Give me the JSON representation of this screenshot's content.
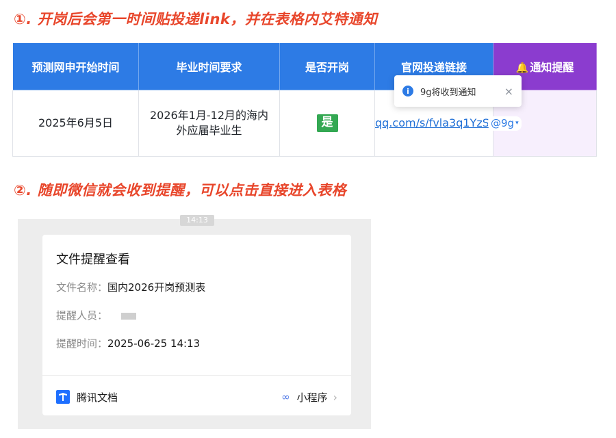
{
  "steps": {
    "step1": "①. 开岗后会第一时间贴投递link，并在表格内艾特通知",
    "step2": "②. 随即微信就会收到提醒，可以点击直接进入表格"
  },
  "table": {
    "headers": [
      "预测网申开始时间",
      "毕业时间要求",
      "是否开岗",
      "官网投递链接",
      "通知提醒"
    ],
    "row": {
      "start_time": "2025年6月5日",
      "grad_req": "2026年1月-12月的海内外应届毕业生",
      "is_open": "是",
      "link": ".qq.com/s/fvla3q1YzS",
      "mention": "@9g"
    }
  },
  "popup": {
    "text": "9g将收到通知",
    "close": "×",
    "info": "i"
  },
  "wechat": {
    "time_stub": "14:13",
    "card": {
      "title": "文件提醒查看",
      "file_name_label": "文件名称：",
      "file_name_value": "国内2026开岗预测表",
      "reminder_label": "提醒人员：",
      "time_label": "提醒时间：",
      "time_value": "2025-06-25 14:13",
      "brand": "腾讯文档",
      "mini_program": "小程序"
    }
  },
  "colors": {
    "title_red": "#e8462b",
    "header_blue": "#2d7be5",
    "header_purple": "#8b3ccf",
    "badge_green": "#34a853"
  },
  "icons": [
    "info-icon",
    "close-icon",
    "bell-icon",
    "tencent-docs-logo",
    "mini-program-icon",
    "chevron-right-icon"
  ]
}
